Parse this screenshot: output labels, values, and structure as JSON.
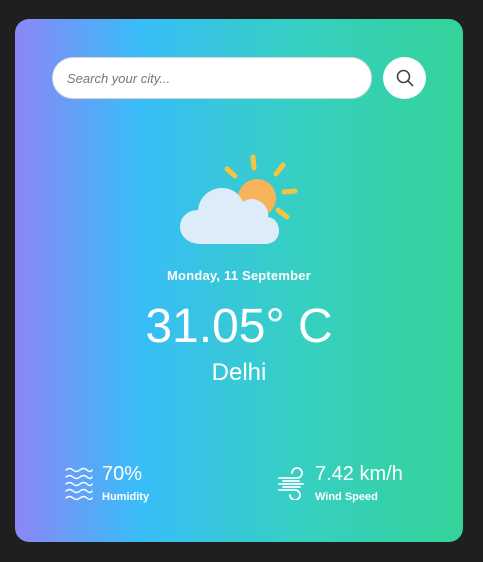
{
  "search": {
    "placeholder": "Search your city...",
    "icon": "search-icon"
  },
  "weather": {
    "icon": "partly-cloudy-icon",
    "date": "Monday, 11 September",
    "temperature": "31.05° C",
    "city": "Delhi"
  },
  "stats": {
    "humidity": {
      "value": "70%",
      "label": "Humidity",
      "icon": "humidity-waves-icon"
    },
    "wind": {
      "value": "7.42 km/h",
      "label": "Wind Speed",
      "icon": "wind-icon"
    }
  },
  "colors": {
    "background": "#1f1f1f",
    "gradient_start": "#8b86f7",
    "gradient_mid": "#38bdf8",
    "gradient_end": "#34d399",
    "sun": "#f7b45a",
    "sun_rays": "#f5c542",
    "cloud": "#dcecf9"
  }
}
